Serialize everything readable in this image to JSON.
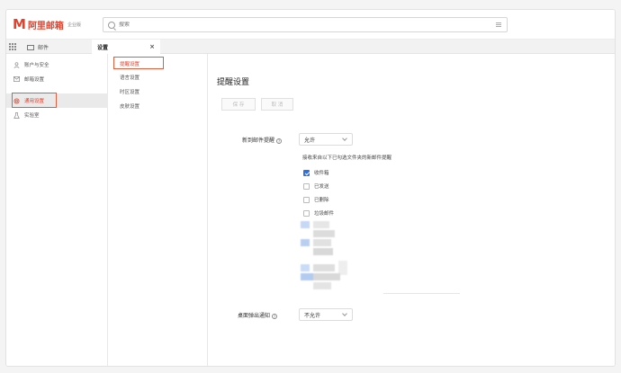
{
  "app": {
    "logo_mark": "M",
    "logo_name": "阿里邮箱",
    "logo_edition": "企业版",
    "brand_color": "#e8402a"
  },
  "search": {
    "placeholder": "搜索"
  },
  "tabs": [
    {
      "label": "邮件"
    },
    {
      "label": "设置"
    }
  ],
  "sidebar": {
    "items": [
      {
        "label": "账户与安全",
        "icon": "user-icon"
      },
      {
        "label": "邮箱设置",
        "icon": "mail-icon"
      },
      {
        "label": "通用设置",
        "icon": "gear-icon",
        "active": true
      },
      {
        "label": "实验室",
        "icon": "lab-icon"
      }
    ]
  },
  "subnav": {
    "items": [
      {
        "label": "提醒设置",
        "active": true
      },
      {
        "label": "语言设置"
      },
      {
        "label": "时区设置"
      },
      {
        "label": "皮肤设置"
      }
    ]
  },
  "main": {
    "title": "提醒设置",
    "save_label": "保 存",
    "cancel_label": "取 消",
    "new_mail_label": "新到邮件提醒",
    "new_mail_value": "允许",
    "folders_desc": "接收来自以下已勾选文件夹的新邮件提醒",
    "folders": [
      {
        "label": "收件箱",
        "checked": true
      },
      {
        "label": "已发送",
        "checked": false
      },
      {
        "label": "已删除",
        "checked": false
      },
      {
        "label": "垃圾邮件",
        "checked": false
      }
    ],
    "desktop_label": "桌面弹出通知",
    "desktop_value": "不允许"
  }
}
